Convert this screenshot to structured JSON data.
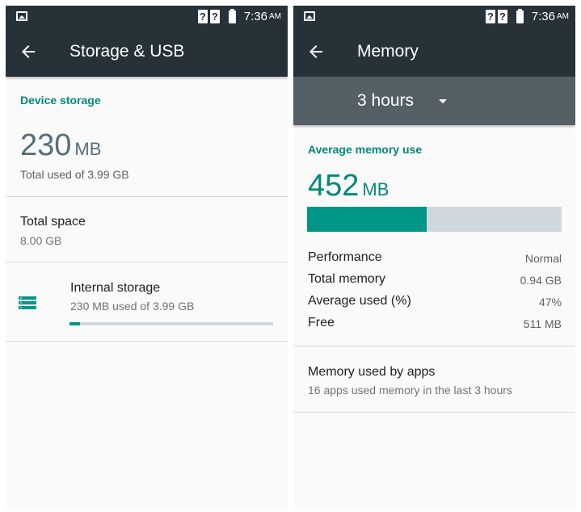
{
  "status_bar": {
    "time": "7:36",
    "ampm": "AM",
    "signal_glyph": "?"
  },
  "left": {
    "title": "Storage & USB",
    "device_storage_header": "Device storage",
    "used_value": "230",
    "used_unit": "MB",
    "total_used_text": "Total used of 3.99 GB",
    "total_space_label": "Total space",
    "total_space_value": "8.00 GB",
    "internal_storage_label": "Internal storage",
    "internal_storage_sub": "230 MB used of 3.99 GB",
    "internal_storage_fraction": 0.05
  },
  "right": {
    "title": "Memory",
    "time_range": "3 hours",
    "avg_header": "Average memory use",
    "avg_value": "452",
    "avg_unit": "MB",
    "avg_fraction": 0.47,
    "stats": [
      {
        "label": "Performance",
        "value": "Normal"
      },
      {
        "label": "Total memory",
        "value": "0.94 GB"
      },
      {
        "label": "Average used (%)",
        "value": "47%"
      },
      {
        "label": "Free",
        "value": "511 MB"
      }
    ],
    "apps_label": "Memory used by apps",
    "apps_sub": "16 apps used memory in the last 3 hours"
  },
  "colors": {
    "toolbar": "#263238",
    "accent": "#009688",
    "spinner_bar": "#546066",
    "bar_track": "#cfd8dc"
  },
  "icons": [
    "image-notification-icon",
    "signal-unknown-icon",
    "battery-icon",
    "back-arrow-icon",
    "storage-icon",
    "dropdown-arrow-icon"
  ]
}
